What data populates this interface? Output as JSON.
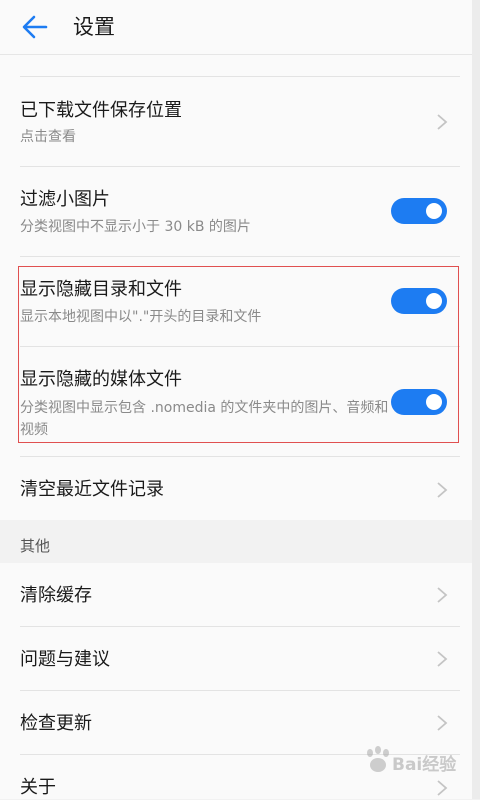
{
  "header": {
    "title": "设置"
  },
  "items": [
    {
      "label": "已下载文件保存位置",
      "sub": "点击查看"
    },
    {
      "label": "过滤小图片",
      "sub": "分类视图中不显示小于 30 kB 的图片",
      "toggle": "on"
    },
    {
      "label": "显示隐藏目录和文件",
      "sub": "显示本地视图中以\".\"开头的目录和文件",
      "toggle": "on"
    },
    {
      "label": "显示隐藏的媒体文件",
      "sub": "分类视图中显示包含 .nomedia 的文件夹中的图片、音频和视频",
      "toggle": "on"
    },
    {
      "label": "清空最近文件记录"
    }
  ],
  "other_section": {
    "title": "其他",
    "items": [
      {
        "label": "清除缓存"
      },
      {
        "label": "问题与建议"
      },
      {
        "label": "检查更新"
      },
      {
        "label": "关于"
      }
    ]
  },
  "watermark": {
    "text": "Bai经验"
  },
  "colors": {
    "accent": "#1d7cf2",
    "highlight_border": "#e05050"
  }
}
